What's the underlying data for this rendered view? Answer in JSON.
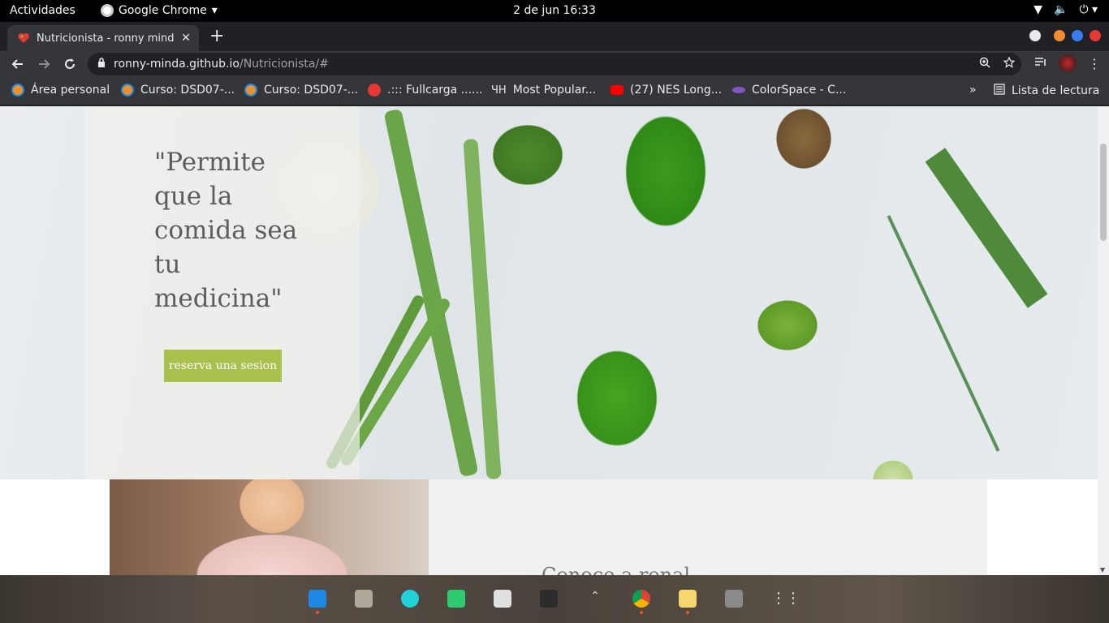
{
  "system": {
    "activities": "Actividades",
    "app_name": "Google Chrome",
    "clock": "2 de jun  16:33"
  },
  "browser": {
    "tab_title": "Nutricionista - ronny mind",
    "url_host": "ronny-minda.github.io",
    "url_path": "/Nutricionista/#",
    "bookmarks": [
      {
        "label": "Área personal",
        "color": "#e8912d"
      },
      {
        "label": "Curso: DSD07-...",
        "color": "#e8912d"
      },
      {
        "label": "Curso: DSD07-...",
        "color": "#e8912d"
      },
      {
        "label": ".::: Fullcarga ......",
        "color": "#e53935"
      },
      {
        "label": "Most Popular...",
        "color": "#e8eaed"
      },
      {
        "label": "(27) NES Long...",
        "color": "#ff0000"
      },
      {
        "label": "ColorSpace - C...",
        "color": "#7e57c2"
      }
    ],
    "more_bookmarks": "»",
    "reading_list": "Lista de lectura"
  },
  "page": {
    "quote": "\"Permite que la comida sea tu medicina\"",
    "cta": "reserva una sesion",
    "section_heading_partial": "Conoce a renal"
  },
  "colors": {
    "cta_bg": "#a8c14c",
    "chrome_dark": "#202124",
    "chrome_toolbar": "#35363a"
  }
}
